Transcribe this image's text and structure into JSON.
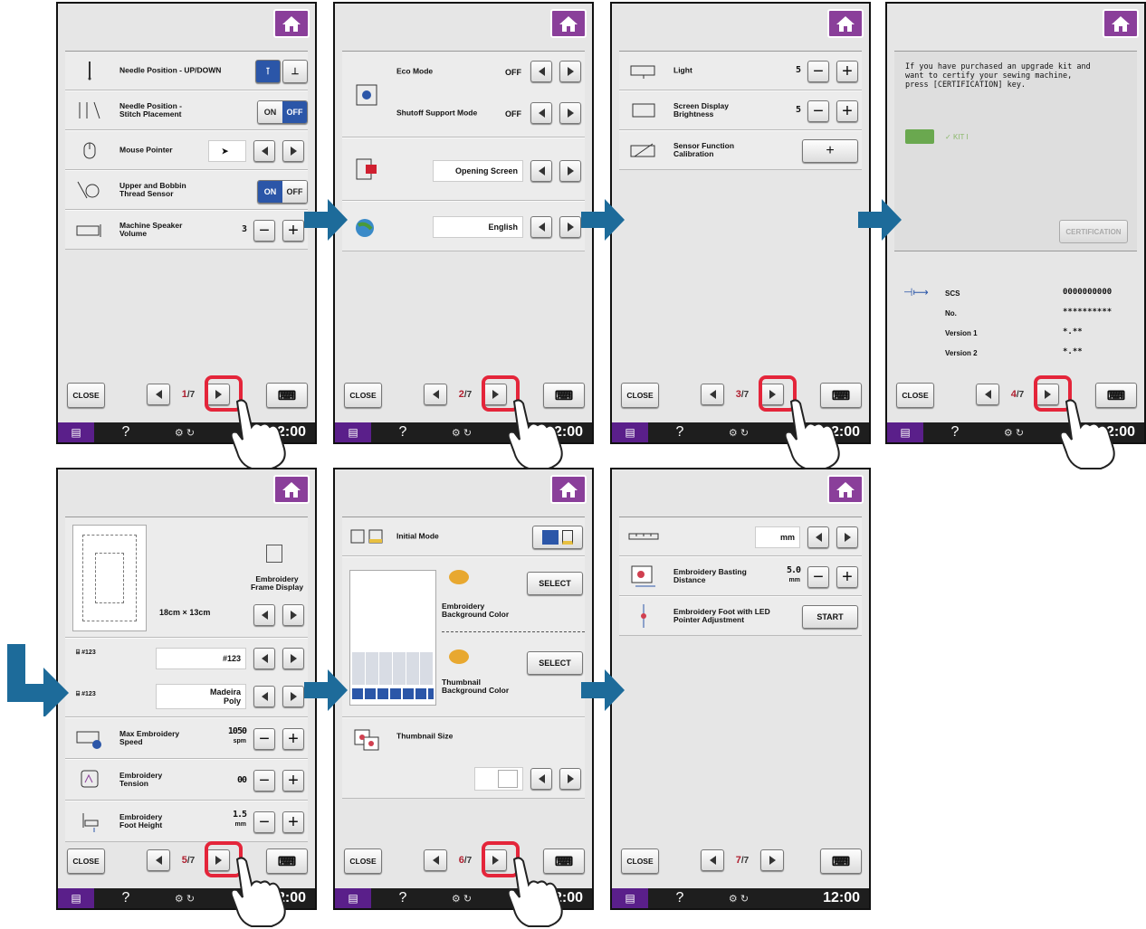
{
  "common": {
    "close": "CLOSE",
    "help": "?",
    "time": "12:00",
    "denominator": "7",
    "colors": {
      "home": "#8a3f9a",
      "taskbar_memo": "#5a1f8a",
      "arrow": "#1d6b9a",
      "ring": "#e4253a",
      "toggle_on": "#2b56a8"
    }
  },
  "pages": [
    {
      "page": "1",
      "rows": [
        {
          "label": "Needle Position - UP/DOWN",
          "icon": "needle-updown-icon"
        },
        {
          "label": "Needle Position -\nStitch Placement",
          "icon": "needle-stitch-icon",
          "on": "ON",
          "off": "OFF",
          "active": "off"
        },
        {
          "label": "Mouse Pointer",
          "icon": "mouse-icon"
        },
        {
          "label": "Upper and Bobbin\nThread Sensor",
          "icon": "thread-sensor-icon",
          "on": "ON",
          "off": "OFF",
          "active": "on"
        },
        {
          "label": "Machine Speaker\nVolume",
          "icon": "speaker-icon",
          "value": "3"
        }
      ]
    },
    {
      "page": "2",
      "rows": [
        {
          "label": "Eco Mode",
          "value": "OFF"
        },
        {
          "label": "Shutoff Support Mode",
          "value": "OFF"
        },
        {
          "label": "Opening Screen"
        },
        {
          "label": "English"
        }
      ]
    },
    {
      "page": "3",
      "rows": [
        {
          "label": "Light",
          "value": "5"
        },
        {
          "label": "Screen Display\nBrightness",
          "value": "5"
        },
        {
          "label": "Sensor Function\nCalibration",
          "button": "+"
        }
      ]
    },
    {
      "page": "4",
      "message": "If you have purchased an upgrade kit and\nwant to certify your sewing machine,\npress [CERTIFICATION] key.",
      "kit": "KIT I",
      "certification": "CERTIFICATION",
      "info": [
        {
          "label": "SCS",
          "value": "0000000000"
        },
        {
          "label": "No.",
          "value": "**********"
        },
        {
          "label": "Version 1",
          "value": "*.**"
        },
        {
          "label": "Version 2",
          "value": "*.**"
        }
      ]
    },
    {
      "page": "5",
      "frame_label": "Embroidery\nFrame Display",
      "frame_size_1": "18cm",
      "frame_size_x": "×",
      "frame_size_2": "13cm",
      "thread_no": "#123",
      "thread_brand": "Madeira\nPoly",
      "rows": [
        {
          "label": "Max Embroidery\nSpeed",
          "value": "1050",
          "unit": "spm"
        },
        {
          "label": "Embroidery\nTension",
          "value": "00"
        },
        {
          "label": "Embroidery\nFoot Height",
          "value": "1.5",
          "unit": "mm"
        }
      ]
    },
    {
      "page": "6",
      "initial_mode": "Initial Mode",
      "select": "SELECT",
      "emb_bg": "Embroidery\nBackground Color",
      "thumb_bg": "Thumbnail\nBackground Color",
      "thumb_size": "Thumbnail Size"
    },
    {
      "page": "7",
      "unit": "mm",
      "basting": "Embroidery Basting\nDistance",
      "basting_value": "5.0",
      "basting_unit": "mm",
      "led": "Embroidery Foot with LED\nPointer Adjustment",
      "start": "START"
    }
  ]
}
